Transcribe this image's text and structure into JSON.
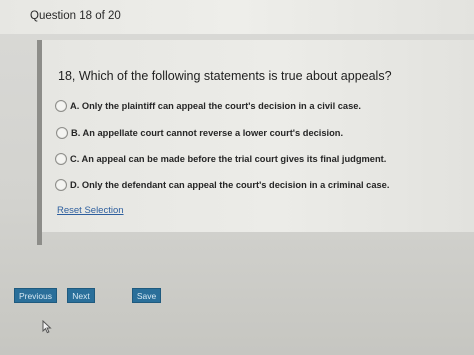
{
  "header": {
    "question_counter": "Question 18 of 20"
  },
  "question": {
    "text": "18, Which of the following statements is true about appeals?",
    "options": [
      {
        "label": "A. Only the plaintiff can appeal the court's decision in a civil case."
      },
      {
        "label": "B. An appellate court cannot reverse a lower court's decision."
      },
      {
        "label": "C. An appeal can be made before the trial court gives its final judgment."
      },
      {
        "label": "D. Only the defendant can appeal the court's decision in a criminal case."
      }
    ],
    "reset_label": "Reset Selection"
  },
  "navigation": {
    "previous_label": "Previous",
    "next_label": "Next",
    "save_label": "Save"
  },
  "icons": {
    "cursor": "mouse-pointer-icon"
  },
  "colors": {
    "button_bg": "#2a6f9a",
    "link": "#2e5f9e",
    "page_bg": "#d9d9d6"
  }
}
